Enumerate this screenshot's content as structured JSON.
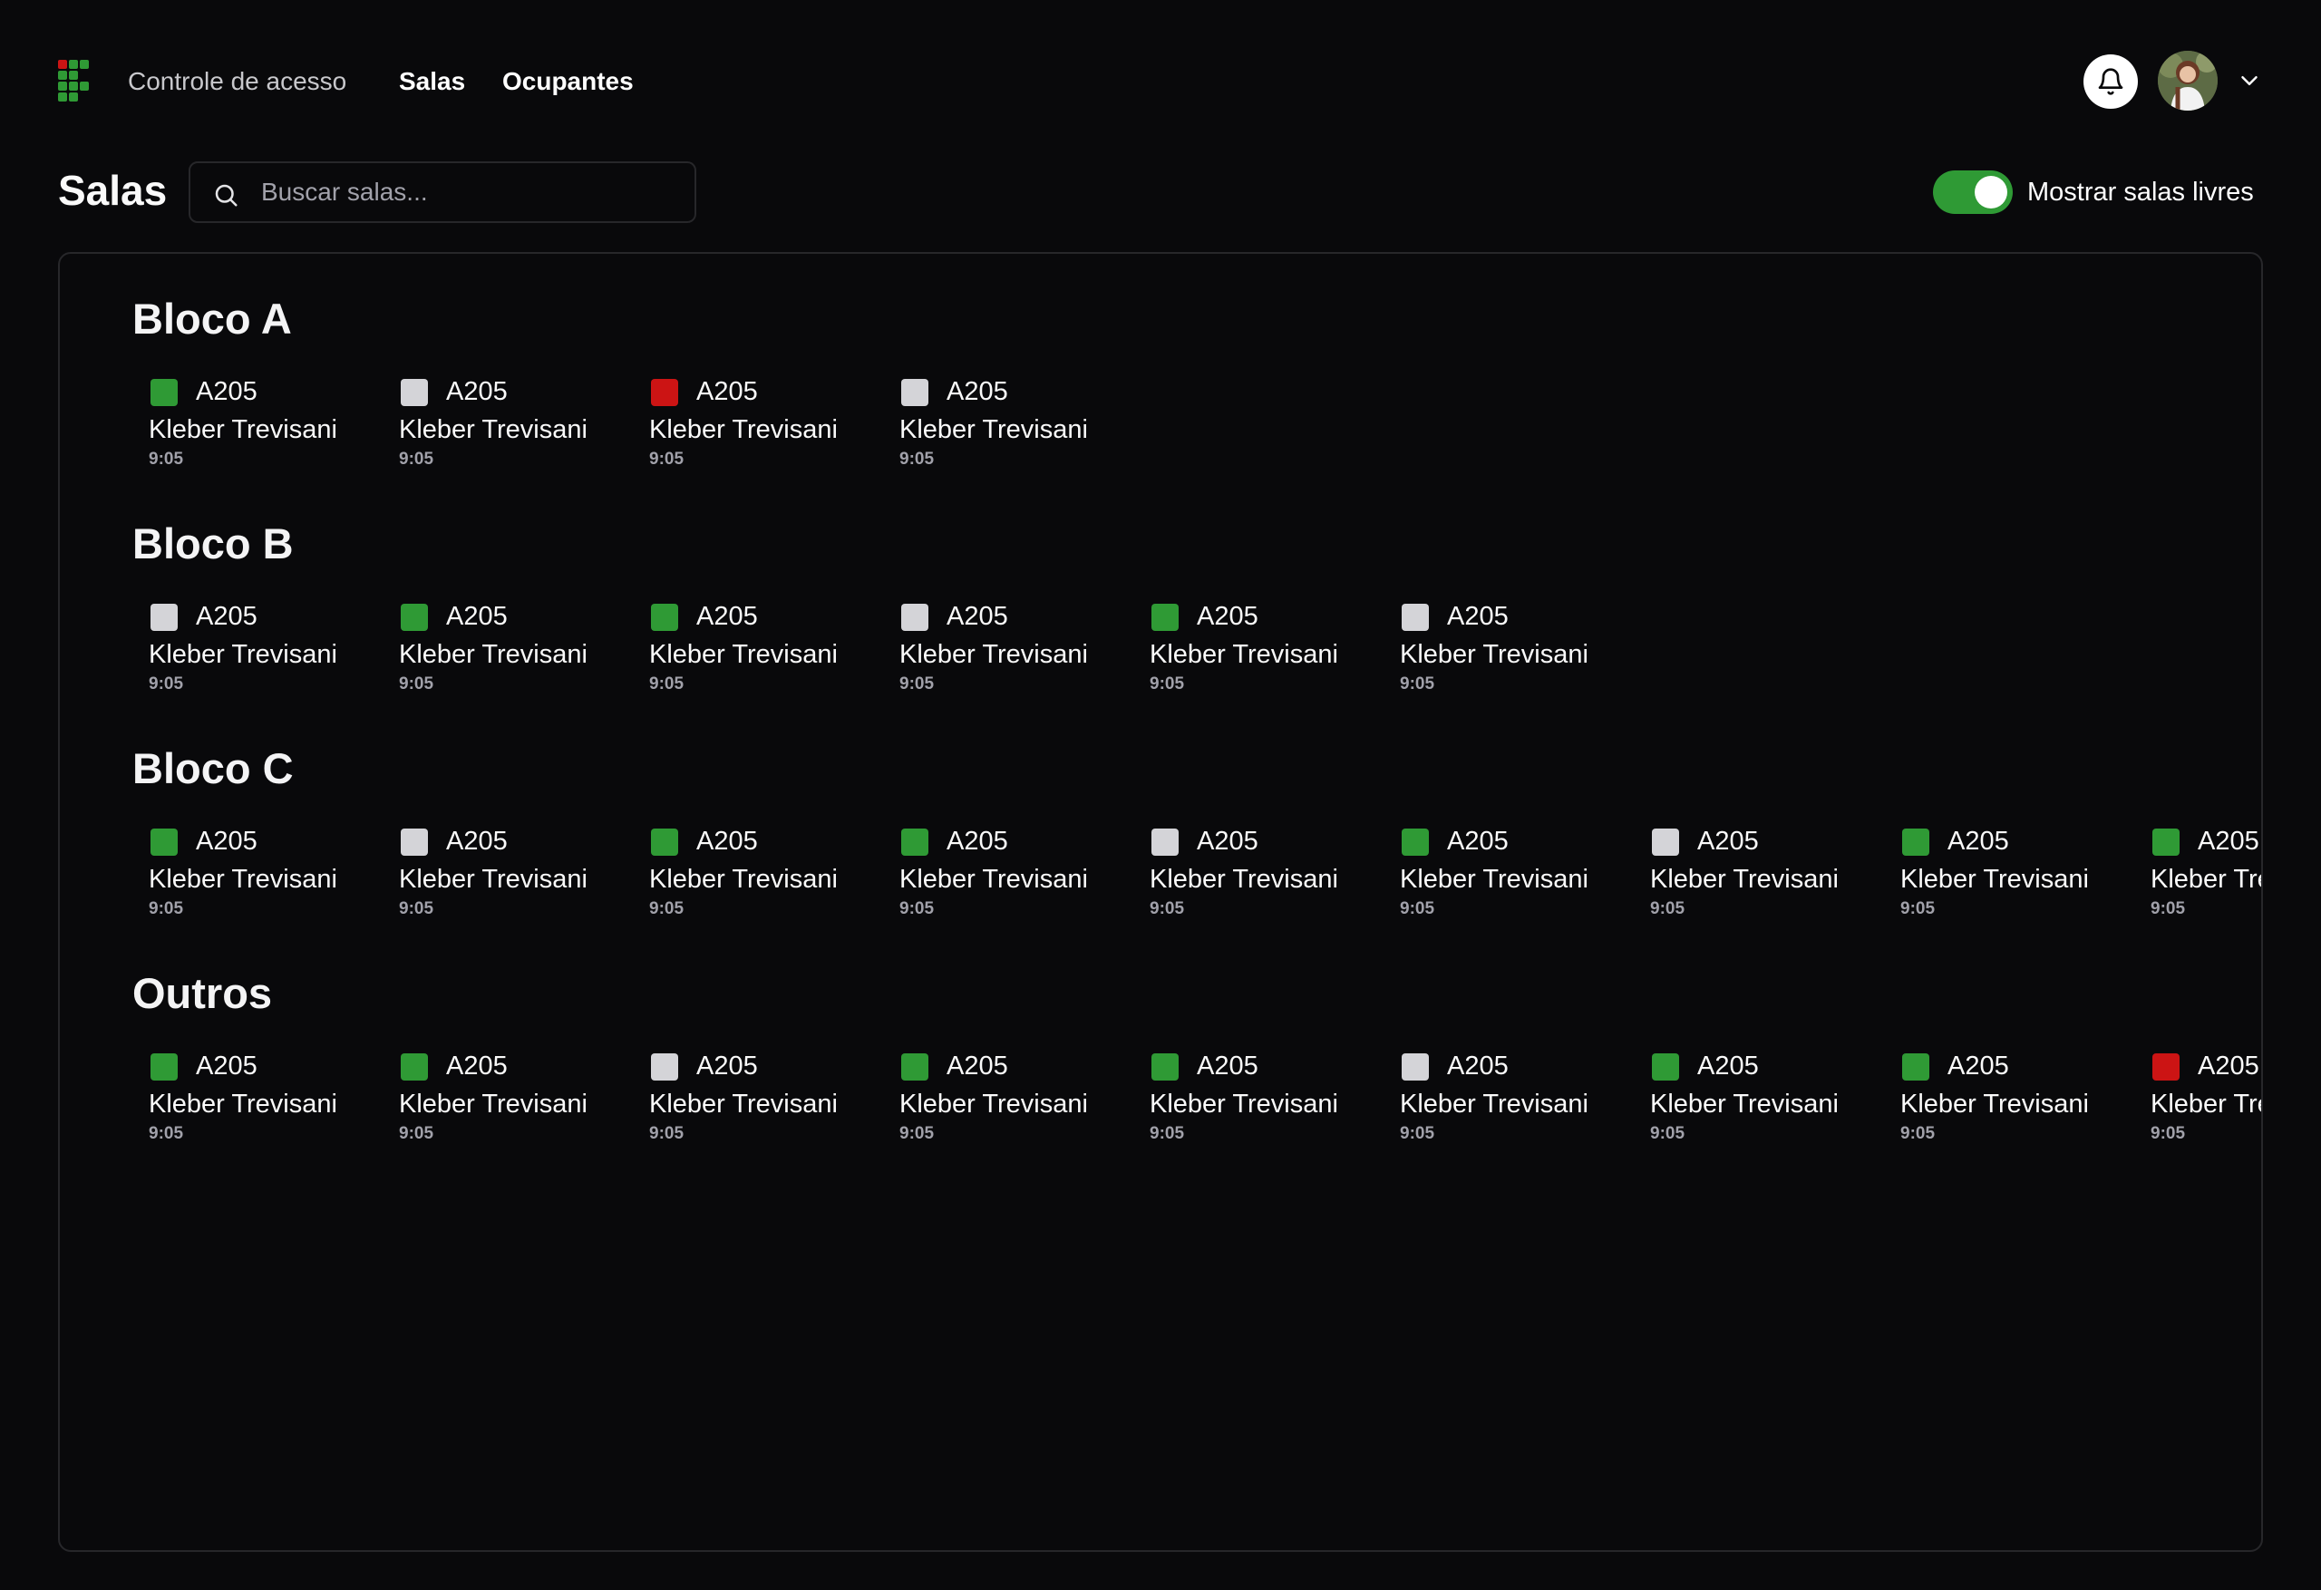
{
  "nav": {
    "app_title": "Controle de acesso",
    "links": [
      "Salas",
      "Ocupantes"
    ],
    "notifications_icon": "bell-icon",
    "user_menu_icon": "chevron-down-icon"
  },
  "header": {
    "title": "Salas",
    "search_placeholder": "Buscar salas...",
    "search_value": "",
    "toggle_label": "Mostrar salas livres",
    "toggle_on": true
  },
  "colors": {
    "livre": "#2f9a35",
    "ocupada": "#d4d4d8",
    "alerta": "#cc1414",
    "accent": "#2f9a35"
  },
  "sections": [
    {
      "title": "Bloco A",
      "rooms": [
        {
          "code": "A205",
          "person": "Kleber Trevisani",
          "time": "9:05",
          "status": "livre"
        },
        {
          "code": "A205",
          "person": "Kleber Trevisani",
          "time": "9:05",
          "status": "ocupada"
        },
        {
          "code": "A205",
          "person": "Kleber Trevisani",
          "time": "9:05",
          "status": "alerta"
        },
        {
          "code": "A205",
          "person": "Kleber Trevisani",
          "time": "9:05",
          "status": "ocupada"
        }
      ]
    },
    {
      "title": "Bloco B",
      "rooms": [
        {
          "code": "A205",
          "person": "Kleber Trevisani",
          "time": "9:05",
          "status": "ocupada"
        },
        {
          "code": "A205",
          "person": "Kleber Trevisani",
          "time": "9:05",
          "status": "livre"
        },
        {
          "code": "A205",
          "person": "Kleber Trevisani",
          "time": "9:05",
          "status": "livre"
        },
        {
          "code": "A205",
          "person": "Kleber Trevisani",
          "time": "9:05",
          "status": "ocupada"
        },
        {
          "code": "A205",
          "person": "Kleber Trevisani",
          "time": "9:05",
          "status": "livre"
        },
        {
          "code": "A205",
          "person": "Kleber Trevisani",
          "time": "9:05",
          "status": "ocupada"
        }
      ]
    },
    {
      "title": "Bloco C",
      "rooms": [
        {
          "code": "A205",
          "person": "Kleber Trevisani",
          "time": "9:05",
          "status": "livre"
        },
        {
          "code": "A205",
          "person": "Kleber Trevisani",
          "time": "9:05",
          "status": "ocupada"
        },
        {
          "code": "A205",
          "person": "Kleber Trevisani",
          "time": "9:05",
          "status": "livre"
        },
        {
          "code": "A205",
          "person": "Kleber Trevisani",
          "time": "9:05",
          "status": "livre"
        },
        {
          "code": "A205",
          "person": "Kleber Trevisani",
          "time": "9:05",
          "status": "ocupada"
        },
        {
          "code": "A205",
          "person": "Kleber Trevisani",
          "time": "9:05",
          "status": "livre"
        },
        {
          "code": "A205",
          "person": "Kleber Trevisani",
          "time": "9:05",
          "status": "ocupada"
        },
        {
          "code": "A205",
          "person": "Kleber Trevisani",
          "time": "9:05",
          "status": "livre"
        },
        {
          "code": "A205",
          "person": "Kleber Trevisani",
          "time": "9:05",
          "status": "livre"
        }
      ]
    },
    {
      "title": "Outros",
      "rooms": [
        {
          "code": "A205",
          "person": "Kleber Trevisani",
          "time": "9:05",
          "status": "livre"
        },
        {
          "code": "A205",
          "person": "Kleber Trevisani",
          "time": "9:05",
          "status": "livre"
        },
        {
          "code": "A205",
          "person": "Kleber Trevisani",
          "time": "9:05",
          "status": "ocupada"
        },
        {
          "code": "A205",
          "person": "Kleber Trevisani",
          "time": "9:05",
          "status": "livre"
        },
        {
          "code": "A205",
          "person": "Kleber Trevisani",
          "time": "9:05",
          "status": "livre"
        },
        {
          "code": "A205",
          "person": "Kleber Trevisani",
          "time": "9:05",
          "status": "ocupada"
        },
        {
          "code": "A205",
          "person": "Kleber Trevisani",
          "time": "9:05",
          "status": "livre"
        },
        {
          "code": "A205",
          "person": "Kleber Trevisani",
          "time": "9:05",
          "status": "livre"
        },
        {
          "code": "A205",
          "person": "Kleber Trevisani",
          "time": "9:05",
          "status": "alerta"
        }
      ]
    }
  ]
}
